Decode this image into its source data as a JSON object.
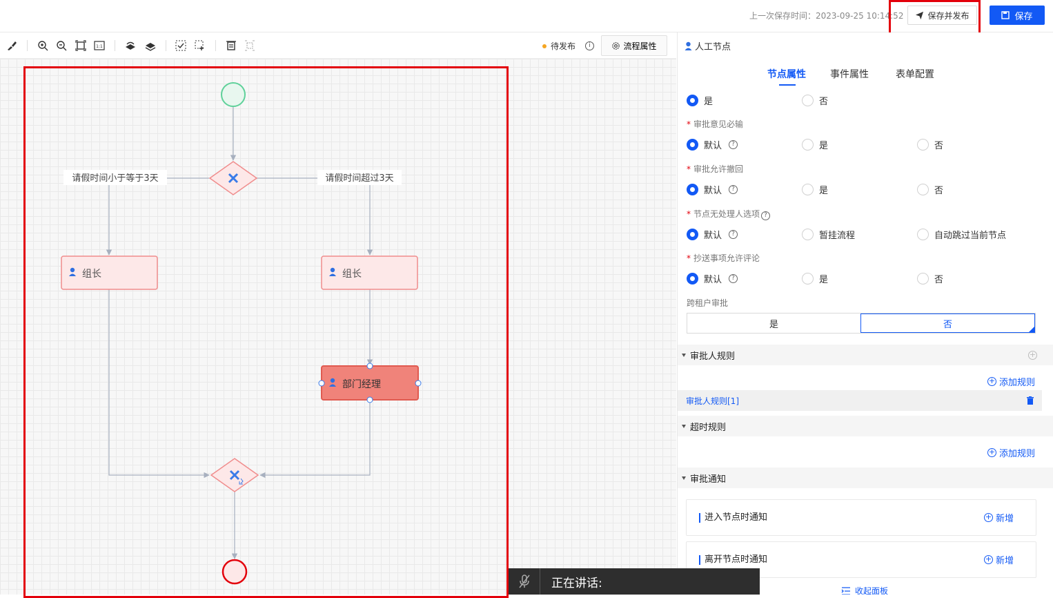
{
  "header": {
    "last_save_label": "上一次保存时间：2023-09-25 10:14:52",
    "save_publish_label": "保存并发布",
    "save_label": "保存"
  },
  "toolbar": {
    "status_label": "待发布",
    "flow_props_label": "流程属性",
    "status_color": "#f5a623"
  },
  "diagram": {
    "left_condition": "请假时间小于等于3天",
    "right_condition": "请假时间超过3天",
    "left_task": "组长",
    "right_task": "组长",
    "selected_task": "部门经理"
  },
  "panel": {
    "title": "人工节点",
    "tabs": [
      "节点属性",
      "事件属性",
      "表单配置"
    ],
    "top_radio": {
      "yes": "是",
      "no": "否"
    },
    "fields": [
      {
        "label": "审批意见必输",
        "options": [
          "默认",
          "是",
          "否"
        ]
      },
      {
        "label": "审批允许撤回",
        "options": [
          "默认",
          "是",
          "否"
        ]
      },
      {
        "label": "节点无处理人选项",
        "options": [
          "默认",
          "暂挂流程",
          "自动跳过当前节点"
        ]
      },
      {
        "label": "抄送事项允许评论",
        "options": [
          "默认",
          "是",
          "否"
        ]
      }
    ],
    "cross_tenant": {
      "label": "跨租户审批",
      "yes": "是",
      "no": "否"
    },
    "approver_rules": {
      "title": "审批人规则",
      "add_label": "添加规则",
      "rule_item": "审批人规则[1]"
    },
    "timeout_rules": {
      "title": "超时规则",
      "add_label": "添加规则"
    },
    "notify": {
      "title": "审批通知",
      "enter": "进入节点时通知",
      "leave": "离开节点时通知",
      "add_label": "新增"
    },
    "collapse_label": "收起面板"
  },
  "overlay": {
    "speaking_label": "正在讲话:"
  },
  "colors": {
    "accent": "#1259f5",
    "highlight": "#e3000b"
  }
}
